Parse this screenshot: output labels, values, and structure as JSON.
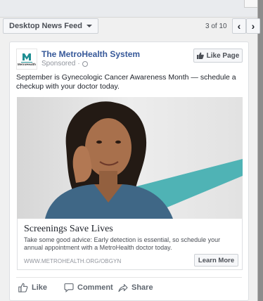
{
  "toolbar": {
    "placement_label": "Desktop News Feed",
    "pager_text": "3 of 10",
    "prev_glyph": "‹",
    "next_glyph": "›"
  },
  "post": {
    "page_name": "The MetroHealth System",
    "logo_text": "MetroHealth",
    "sponsored_label": "Sponsored",
    "sponsored_separator": "·",
    "like_page_label": "Like Page",
    "text": "September is Gynecologic Cancer Awareness Month — schedule a checkup with your doctor today.",
    "link": {
      "headline": "Screenings Save Lives",
      "description": "Take some good advice: Early detection is essential, so schedule your annual appointment with a MetroHealth doctor today.",
      "domain": "WWW.METROHEALTH.ORG/OBGYN",
      "cta_label": "Learn More"
    },
    "actions": {
      "like": "Like",
      "comment": "Comment",
      "share": "Share"
    }
  },
  "colors": {
    "brand_link": "#365899",
    "accent_stripe": "#4fb3b5",
    "logo_teal": "#1f8f93"
  },
  "icons": [
    "chevron-down-icon",
    "chevron-left-icon",
    "chevron-right-icon",
    "globe-icon",
    "thumbs-up-icon",
    "comment-icon",
    "share-icon"
  ]
}
